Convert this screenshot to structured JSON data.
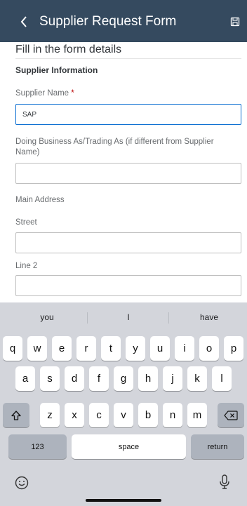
{
  "header": {
    "title": "Supplier Request Form",
    "back_icon": "chevron-left-icon",
    "save_icon": "save-icon"
  },
  "form": {
    "heading": "Fill in the form details",
    "section_title": "Supplier Information",
    "fields": {
      "supplier_name": {
        "label": "Supplier Name",
        "required_mark": "*",
        "value": "SAP"
      },
      "dba": {
        "label": "Doing Business As/Trading As (if different from Supplier Name)",
        "value": ""
      },
      "main_address": {
        "label": "Main Address"
      },
      "street": {
        "label": "Street",
        "value": ""
      },
      "line2": {
        "label": "Line 2",
        "value": ""
      }
    }
  },
  "keyboard": {
    "suggestions": [
      "you",
      "I",
      "have"
    ],
    "row1": [
      "q",
      "w",
      "e",
      "r",
      "t",
      "y",
      "u",
      "i",
      "o",
      "p"
    ],
    "row2": [
      "a",
      "s",
      "d",
      "f",
      "g",
      "h",
      "j",
      "k",
      "l"
    ],
    "row3": [
      "z",
      "x",
      "c",
      "v",
      "b",
      "n",
      "m"
    ],
    "numbers_label": "123",
    "space_label": "space",
    "return_label": "return",
    "shift_icon": "shift-icon",
    "delete_icon": "delete-icon",
    "emoji_icon": "emoji-icon",
    "mic_icon": "microphone-icon"
  },
  "colors": {
    "header_bg": "#354a5f",
    "focus_border": "#0a6ed1",
    "required": "#bb0000",
    "keyboard_bg": "#d3d5db"
  }
}
